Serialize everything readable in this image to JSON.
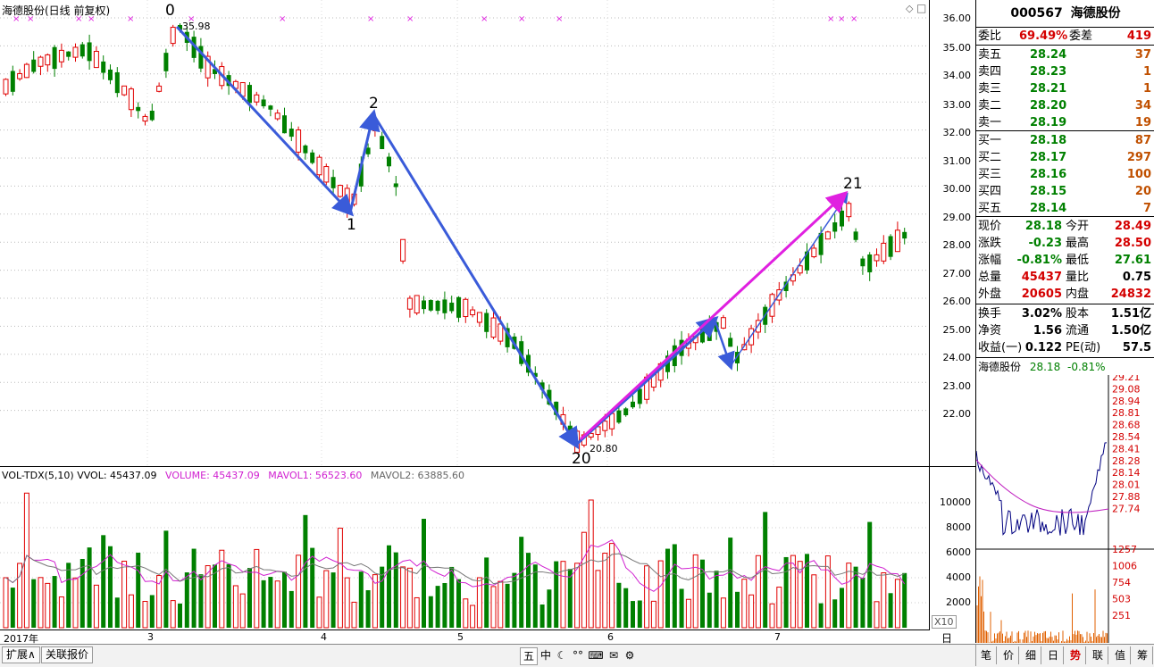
{
  "main": {
    "title": "海德股份(日线 前复权)",
    "marker_labels": [
      "0",
      "1",
      "2",
      "20",
      "21"
    ],
    "high_label": "35.98",
    "low_label": "20.80",
    "price_ticks": [
      "36.00",
      "35.00",
      "34.00",
      "33.00",
      "32.00",
      "31.00",
      "30.00",
      "29.00",
      "28.00",
      "27.00",
      "26.00",
      "25.00",
      "24.00",
      "23.00",
      "22.00"
    ]
  },
  "volume": {
    "title": "VOL-TDX(5,10)",
    "vvol": "VVOL: 45437.09",
    "volume": "VOLUME: 45437.09",
    "mavol1": "MAVOL1: 56523.60",
    "mavol2": "MAVOL2: 63885.60",
    "ticks": [
      "10000",
      "8000",
      "6000",
      "4000",
      "2000"
    ],
    "unit": "X10"
  },
  "dates": {
    "labels": [
      "2017年",
      "3",
      "4",
      "5",
      "6",
      "7"
    ],
    "period": "日线"
  },
  "quote": {
    "code": "000567",
    "name": "海德股份",
    "weibi_label": "委比",
    "weibi": "69.49%",
    "weicha_label": "委差",
    "weicha": "419",
    "sell": [
      {
        "label": "卖五",
        "price": "28.24",
        "vol": "37"
      },
      {
        "label": "卖四",
        "price": "28.23",
        "vol": "1"
      },
      {
        "label": "卖三",
        "price": "28.21",
        "vol": "1"
      },
      {
        "label": "卖二",
        "price": "28.20",
        "vol": "34"
      },
      {
        "label": "卖一",
        "price": "28.19",
        "vol": "19"
      }
    ],
    "buy": [
      {
        "label": "买一",
        "price": "28.18",
        "vol": "87"
      },
      {
        "label": "买二",
        "price": "28.17",
        "vol": "297"
      },
      {
        "label": "买三",
        "price": "28.16",
        "vol": "100"
      },
      {
        "label": "买四",
        "price": "28.15",
        "vol": "20"
      },
      {
        "label": "买五",
        "price": "28.14",
        "vol": "7"
      }
    ],
    "stats": [
      {
        "l1": "现价",
        "v1": "28.18",
        "l2": "今开",
        "v2": "28.49"
      },
      {
        "l1": "涨跌",
        "v1": "-0.23",
        "l2": "最高",
        "v2": "28.50"
      },
      {
        "l1": "涨幅",
        "v1": "-0.81%",
        "l2": "最低",
        "v2": "27.61"
      },
      {
        "l1": "总量",
        "v1": "45437",
        "l2": "量比",
        "v2": "0.75"
      },
      {
        "l1": "外盘",
        "v1": "20605",
        "l2": "内盘",
        "v2": "24832"
      }
    ],
    "fin": [
      {
        "l1": "换手",
        "v1": "3.02%",
        "l2": "股本",
        "v2": "1.51亿"
      },
      {
        "l1": "净资",
        "v1": "1.56",
        "l2": "流通",
        "v2": "1.50亿"
      },
      {
        "l1": "收益(一)",
        "v1": "0.122",
        "l2": "PE(动)",
        "v2": "57.5"
      }
    ]
  },
  "intraday": {
    "name": "海德股份",
    "price": "28.18",
    "pct": "-0.81%",
    "price_ticks": [
      "29.21",
      "29.08",
      "28.94",
      "28.81",
      "28.68",
      "28.54",
      "28.41",
      "28.28",
      "28.14",
      "28.01",
      "27.88",
      "27.74"
    ],
    "vol_ticks": [
      "1257",
      "1006",
      "754",
      "503",
      "251"
    ]
  },
  "toolbar": {
    "expand": "扩展∧",
    "related": "关联报价",
    "tabs": [
      "笔",
      "价",
      "细",
      "日",
      "势",
      "联",
      "值",
      "筹"
    ],
    "tools": [
      "五",
      "中",
      "☾",
      "°°",
      "⌨",
      "✉",
      "⚙",
      "✎"
    ]
  },
  "colors": {
    "up": "#e00000",
    "down": "#008000",
    "arrow_blue": "#3a5bd9",
    "arrow_magenta": "#e020e0"
  }
}
